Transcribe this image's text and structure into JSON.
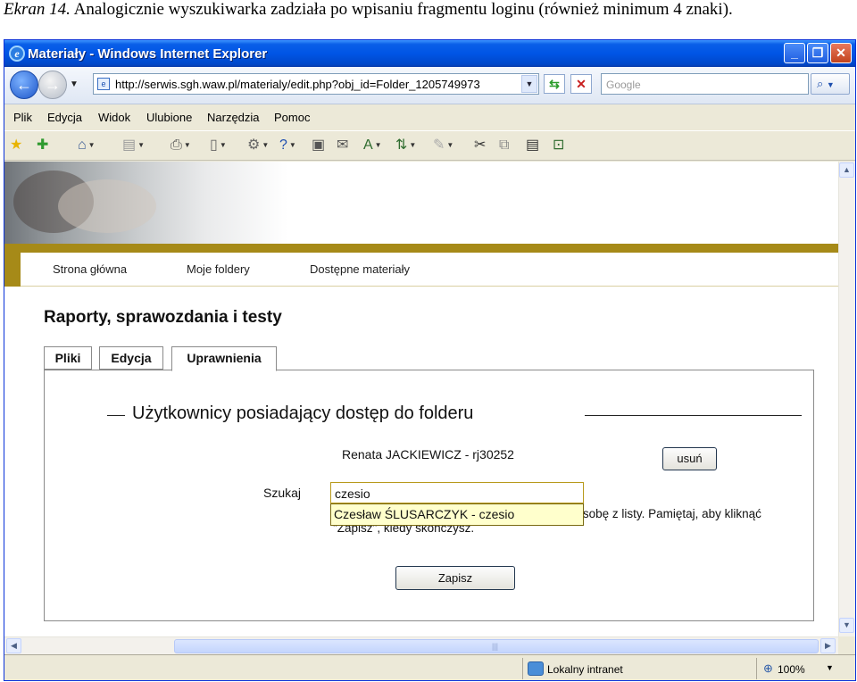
{
  "caption": {
    "prefix": "Ekran 14.",
    "text": "Analogicznie wyszukiwarka zadziała po wpisaniu fragmentu loginu (również minimum 4 znaki)."
  },
  "window": {
    "title": "Materiały - Windows Internet Explorer",
    "url": "http://serwis.sgh.waw.pl/materialy/edit.php?obj_id=Folder_1205749973",
    "search_placeholder": "Google"
  },
  "menu": [
    "Plik",
    "Edycja",
    "Widok",
    "Ulubione",
    "Narzędzia",
    "Pomoc"
  ],
  "toolbar_icons": [
    "favorites-star-icon",
    "add-favorite-icon",
    "home-icon",
    "feeds-icon",
    "print-icon",
    "page-icon",
    "tools-gear-icon",
    "help-icon",
    "research-icon",
    "mail-icon",
    "translate-icon",
    "spelling-icon",
    "pen-icon",
    "cut-icon",
    "copy-icon",
    "paste-icon",
    "window-icon"
  ],
  "site_nav": [
    "Strona główna",
    "Moje foldery",
    "Dostępne materiały"
  ],
  "page": {
    "title": "Raporty, sprawozdania i testy",
    "tabs": [
      {
        "label": "Pliki",
        "active": false
      },
      {
        "label": "Edycja",
        "active": false
      },
      {
        "label": "Uprawnienia",
        "active": true
      }
    ],
    "section_legend": "Użytkownicy posiadający dostęp do folderu",
    "user_entry": "Renata JACKIEWICZ - rj30252",
    "remove_label": "usuń",
    "search_label": "Szukaj",
    "search_value": "czesio",
    "suggestion": "Czesław ŚLUSARCZYK - czesio",
    "hint_text": "Wpisz minimum 4 znaki, a następnie wybierz osobę z listy. Pamiętaj, aby kliknąć \"Zapisz\", kiedy skończysz.",
    "save_label": "Zapisz"
  },
  "status": {
    "zone": "Lokalny intranet",
    "zoom": "100%"
  }
}
